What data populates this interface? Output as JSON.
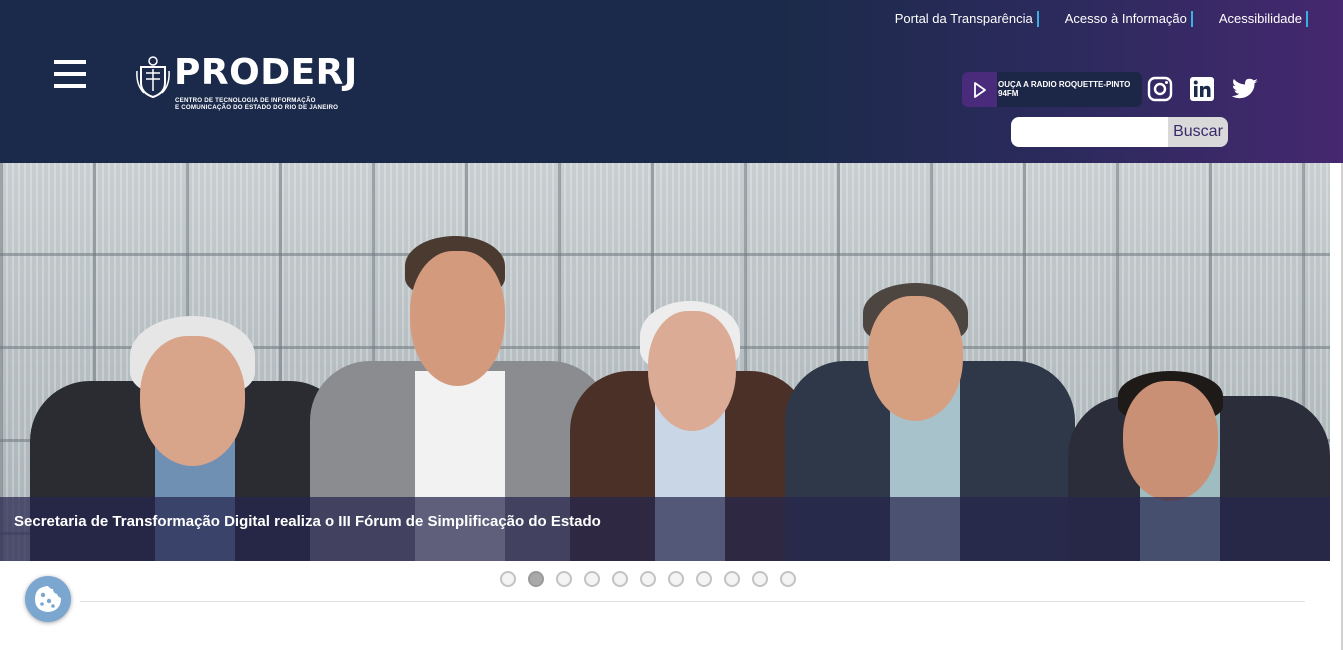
{
  "header": {
    "top_links": [
      "Portal da Transparência",
      "Acesso à Informação",
      "Acessibilidade"
    ],
    "logo": {
      "name": "PRODERJ",
      "subtitle_line1": "CENTRO DE TECNOLOGIA DE INFORMAÇÃO",
      "subtitle_line2": "E COMUNICAÇÃO DO ESTADO DO RIO DE JANEIRO"
    },
    "radio": {
      "line1": "OUÇA A RADIO ROQUETTE-PINTO",
      "line2": "94FM"
    },
    "social_icons": [
      "instagram-icon",
      "linkedin-icon",
      "twitter-icon"
    ],
    "search": {
      "value": "",
      "placeholder": "",
      "button_label": "Buscar"
    }
  },
  "hero": {
    "caption": "Secretaria de Transformação Digital realiza o III Fórum de Simplificação do Estado",
    "slide_count": 11,
    "active_slide": 2
  },
  "colors": {
    "header_bg": "#1b2a4a",
    "header_accent": "#45286f",
    "link_separator": "#3bb0e0",
    "cookie_button": "#7aa6cf"
  }
}
